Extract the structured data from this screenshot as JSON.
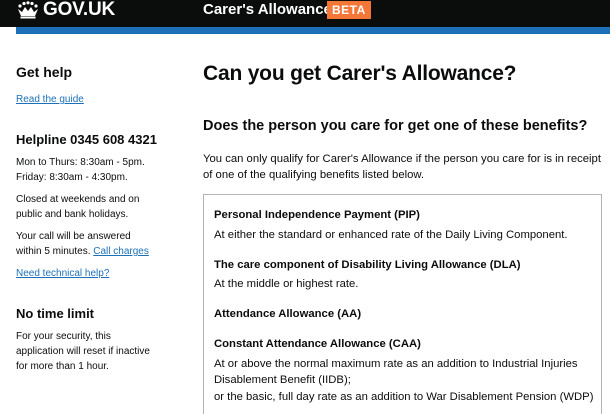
{
  "header": {
    "logo_text": "GOV.UK",
    "service_name": "Carer's Allowance",
    "beta_label": "BETA"
  },
  "sidebar": {
    "get_help_title": "Get help",
    "read_guide_link": "Read the guide",
    "helpline_title": "Helpline 0345 608 4321",
    "hours_line1": "Mon to Thurs: 8:30am - 5pm.",
    "hours_line2": "Friday: 8:30am - 4:30pm.",
    "closed_line1": "Closed at weekends and on",
    "closed_line2": "public and bank holidays.",
    "answer_line1": "Your call will be answered",
    "answer_line2": "within 5 minutes.",
    "call_charges_link": "Call charges",
    "technical_help_link": "Need technical help?",
    "time_limit_title": "No time limit",
    "security_line1": "For your security, this",
    "security_line2": "application will reset if inactive",
    "security_line3": "for more than 1 hour."
  },
  "main": {
    "title": "Can you get Carer's Allowance?",
    "question": "Does the person you care for get one of these benefits?",
    "intro_line1": "You can only qualify for Carer's Allowance if the person you care for is in receipt",
    "intro_line2": "of one of the qualifying benefits listed below.",
    "benefits": {
      "pip_title": "Personal Independence Payment (PIP)",
      "pip_desc": "At either the standard or enhanced rate of the Daily Living Component.",
      "dla_title": "The care component of Disability Living Allowance (DLA)",
      "dla_desc": "At the middle or highest rate.",
      "aa_title": "Attendance Allowance (AA)",
      "caa_title": "Constant Attendance Allowance (CAA)",
      "caa_desc_line1": "At or above the normal maximum rate as an addition to Industrial Injuries",
      "caa_desc_line2": "Disablement Benefit (IIDB);",
      "caa_desc_line3": "or the basic, full day rate as an addition to War Disablement Pension (WDP)"
    }
  },
  "colors": {
    "header_bg": "#0b0c0c",
    "blue_bar": "#1d70b8",
    "beta_tag": "#f47738",
    "link": "#1d70b8",
    "text": "#0b0c0c",
    "box_border": "#b1b4b6"
  },
  "icons": {
    "logo": "crown-icon"
  }
}
